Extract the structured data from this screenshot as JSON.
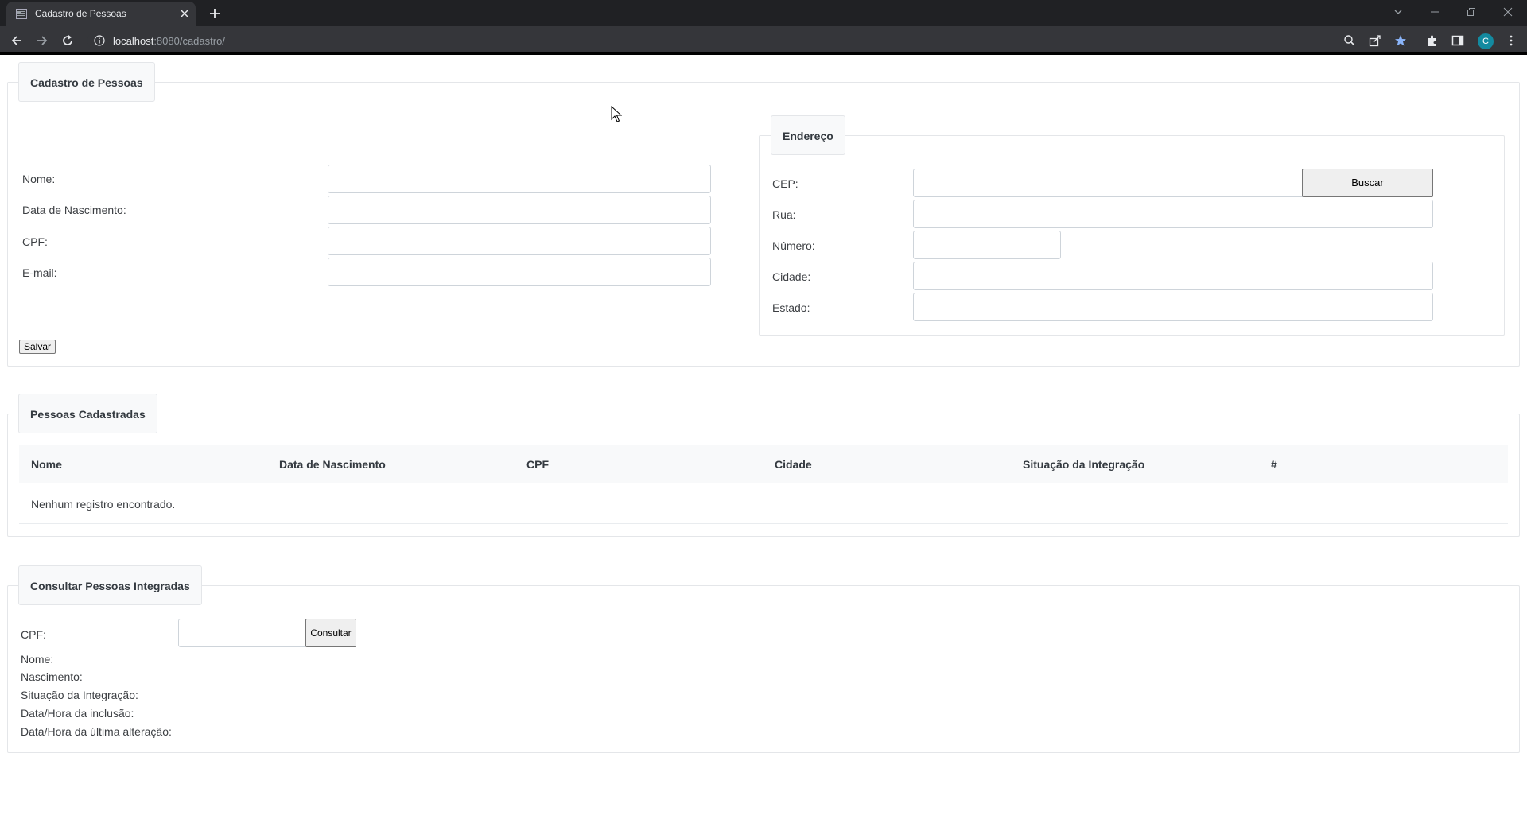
{
  "browser": {
    "tab_title": "Cadastro de Pessoas",
    "url_host": "localhost",
    "url_rest": ":8080/cadastro/",
    "avatar_letter": "C",
    "accent_color": "#8ab4f8"
  },
  "cadastro": {
    "legend": "Cadastro de Pessoas",
    "nome_label": "Nome:",
    "nascimento_label": "Data de Nascimento:",
    "cpf_label": "CPF:",
    "email_label": "E-mail:",
    "nome_value": "",
    "nascimento_value": "",
    "cpf_value": "",
    "email_value": "",
    "salvar_label": "Salvar"
  },
  "endereco": {
    "legend": "Endereço",
    "cep_label": "CEP:",
    "rua_label": "Rua:",
    "numero_label": "Número:",
    "cidade_label": "Cidade:",
    "estado_label": "Estado:",
    "cep_value": "",
    "rua_value": "",
    "numero_value": "",
    "cidade_value": "",
    "estado_value": "",
    "buscar_label": "Buscar"
  },
  "pessoas": {
    "legend": "Pessoas Cadastradas",
    "columns": [
      "Nome",
      "Data de Nascimento",
      "CPF",
      "Cidade",
      "Situação da Integração",
      "#"
    ],
    "empty_message": "Nenhum registro encontrado."
  },
  "consulta": {
    "legend": "Consultar Pessoas Integradas",
    "cpf_label": "CPF:",
    "cpf_value": "",
    "consultar_label": "Consultar",
    "nome_label": "Nome:",
    "nascimento_label": "Nascimento:",
    "situacao_label": "Situação da Integração:",
    "inclusao_label": "Data/Hora da inclusão:",
    "alteracao_label": "Data/Hora da última alteração:"
  }
}
